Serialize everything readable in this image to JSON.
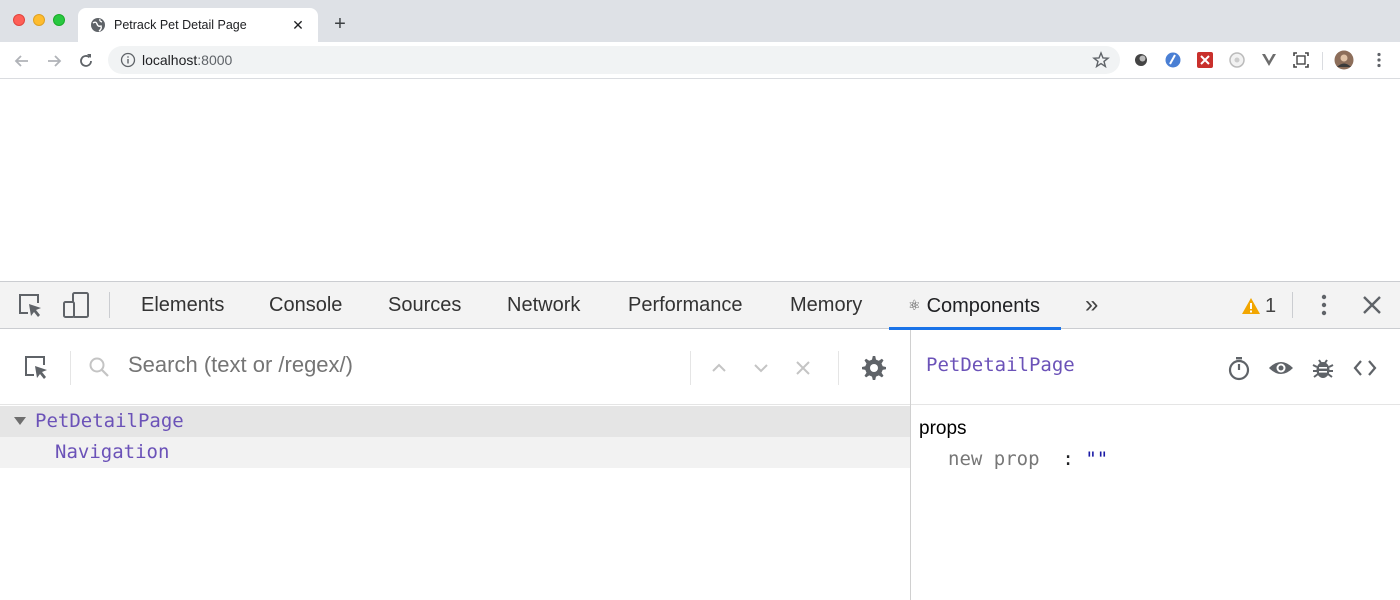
{
  "browser": {
    "tab_title": "Petrack Pet Detail Page",
    "tab_close": "✕",
    "new_tab": "+",
    "url_host": "localhost",
    "url_port": ":8000"
  },
  "devtools": {
    "tabs": [
      "Elements",
      "Console",
      "Sources",
      "Network",
      "Performance",
      "Memory",
      "Components"
    ],
    "react_glyph": "⚛",
    "overflow": "»",
    "warning_count": "1",
    "search_placeholder": "Search (text or /regex/)",
    "tree": [
      {
        "label": "PetDetailPage",
        "selected": true,
        "expanded": true
      },
      {
        "label": "Navigation",
        "selected": false
      }
    ],
    "inspector": {
      "component_name": "PetDetailPage",
      "section": "props",
      "prop_key": "new prop",
      "prop_colon": ":",
      "prop_value": "\"\""
    }
  },
  "icons": {
    "accent": "#1a73e8",
    "component_color": "#6b52b8",
    "warning_color": "#f2a600"
  }
}
